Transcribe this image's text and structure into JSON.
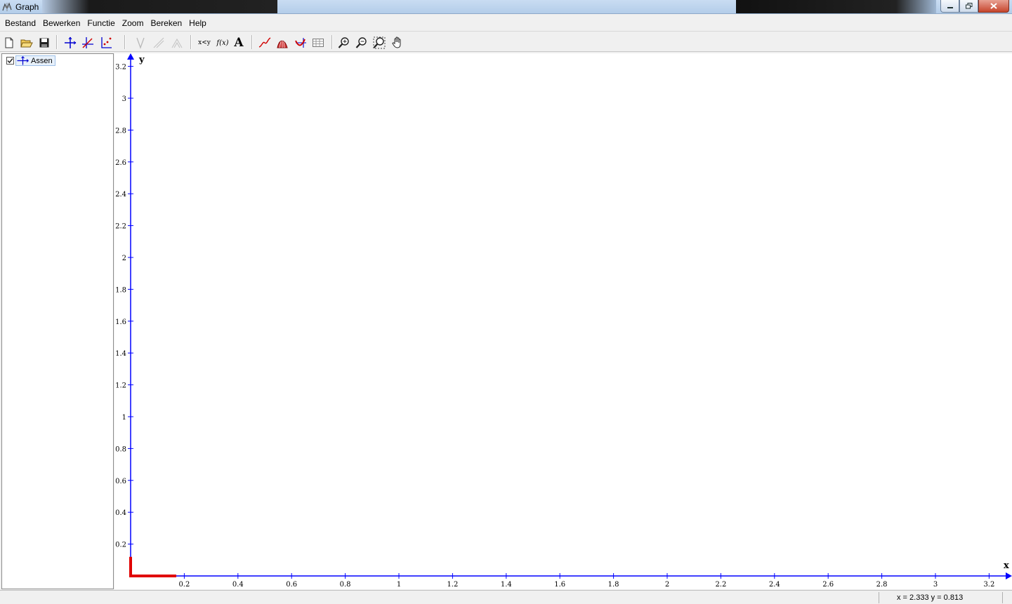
{
  "window": {
    "title": "Graph"
  },
  "menu": [
    "Bestand",
    "Bewerken",
    "Functie",
    "Zoom",
    "Bereken",
    "Help"
  ],
  "toolbar": {
    "tools": [
      "new-file-icon",
      "open-folder-icon",
      "save-icon",
      "axes-icon",
      "insert-function-icon",
      "point-series-icon",
      "tangent-icon",
      "shading-disabled-icon",
      "relation-disabled-icon",
      "xy-label",
      "fx-label",
      "text-label",
      "trendline-icon",
      "area-icon",
      "evaluate-icon",
      "table-icon",
      "zoom-in-icon",
      "zoom-out-icon",
      "zoom-window-icon",
      "pan-hand-icon"
    ],
    "xy_label": "x<y",
    "fx_label": "f(x)",
    "text_label": "A"
  },
  "sidebar": {
    "items": [
      {
        "label": "Assen",
        "checked": true
      }
    ]
  },
  "status": {
    "coords": "x = 2.333   y = 0.813"
  },
  "chart_data": {
    "type": "axes",
    "xlabel": "x",
    "ylabel": "y",
    "xlim": [
      0,
      3.3
    ],
    "ylim": [
      0,
      3.3
    ],
    "xticks": [
      "0.2",
      "0.4",
      "0.6",
      "0.8",
      "1",
      "1.2",
      "1.4",
      "1.6",
      "1.8",
      "2",
      "2.2",
      "2.4",
      "2.6",
      "2.8",
      "3",
      "3.2"
    ],
    "yticks": [
      "0.2",
      "0.4",
      "0.6",
      "0.8",
      "1",
      "1.2",
      "1.4",
      "1.6",
      "1.8",
      "2",
      "2.2",
      "2.4",
      "2.6",
      "2.8",
      "3",
      "3.2"
    ],
    "grid": false,
    "axis_color": "#0000ff",
    "highlight": {
      "color": "#e00000",
      "x_segment": [
        0,
        0.17
      ],
      "y_segment": [
        0,
        0.12
      ]
    }
  }
}
